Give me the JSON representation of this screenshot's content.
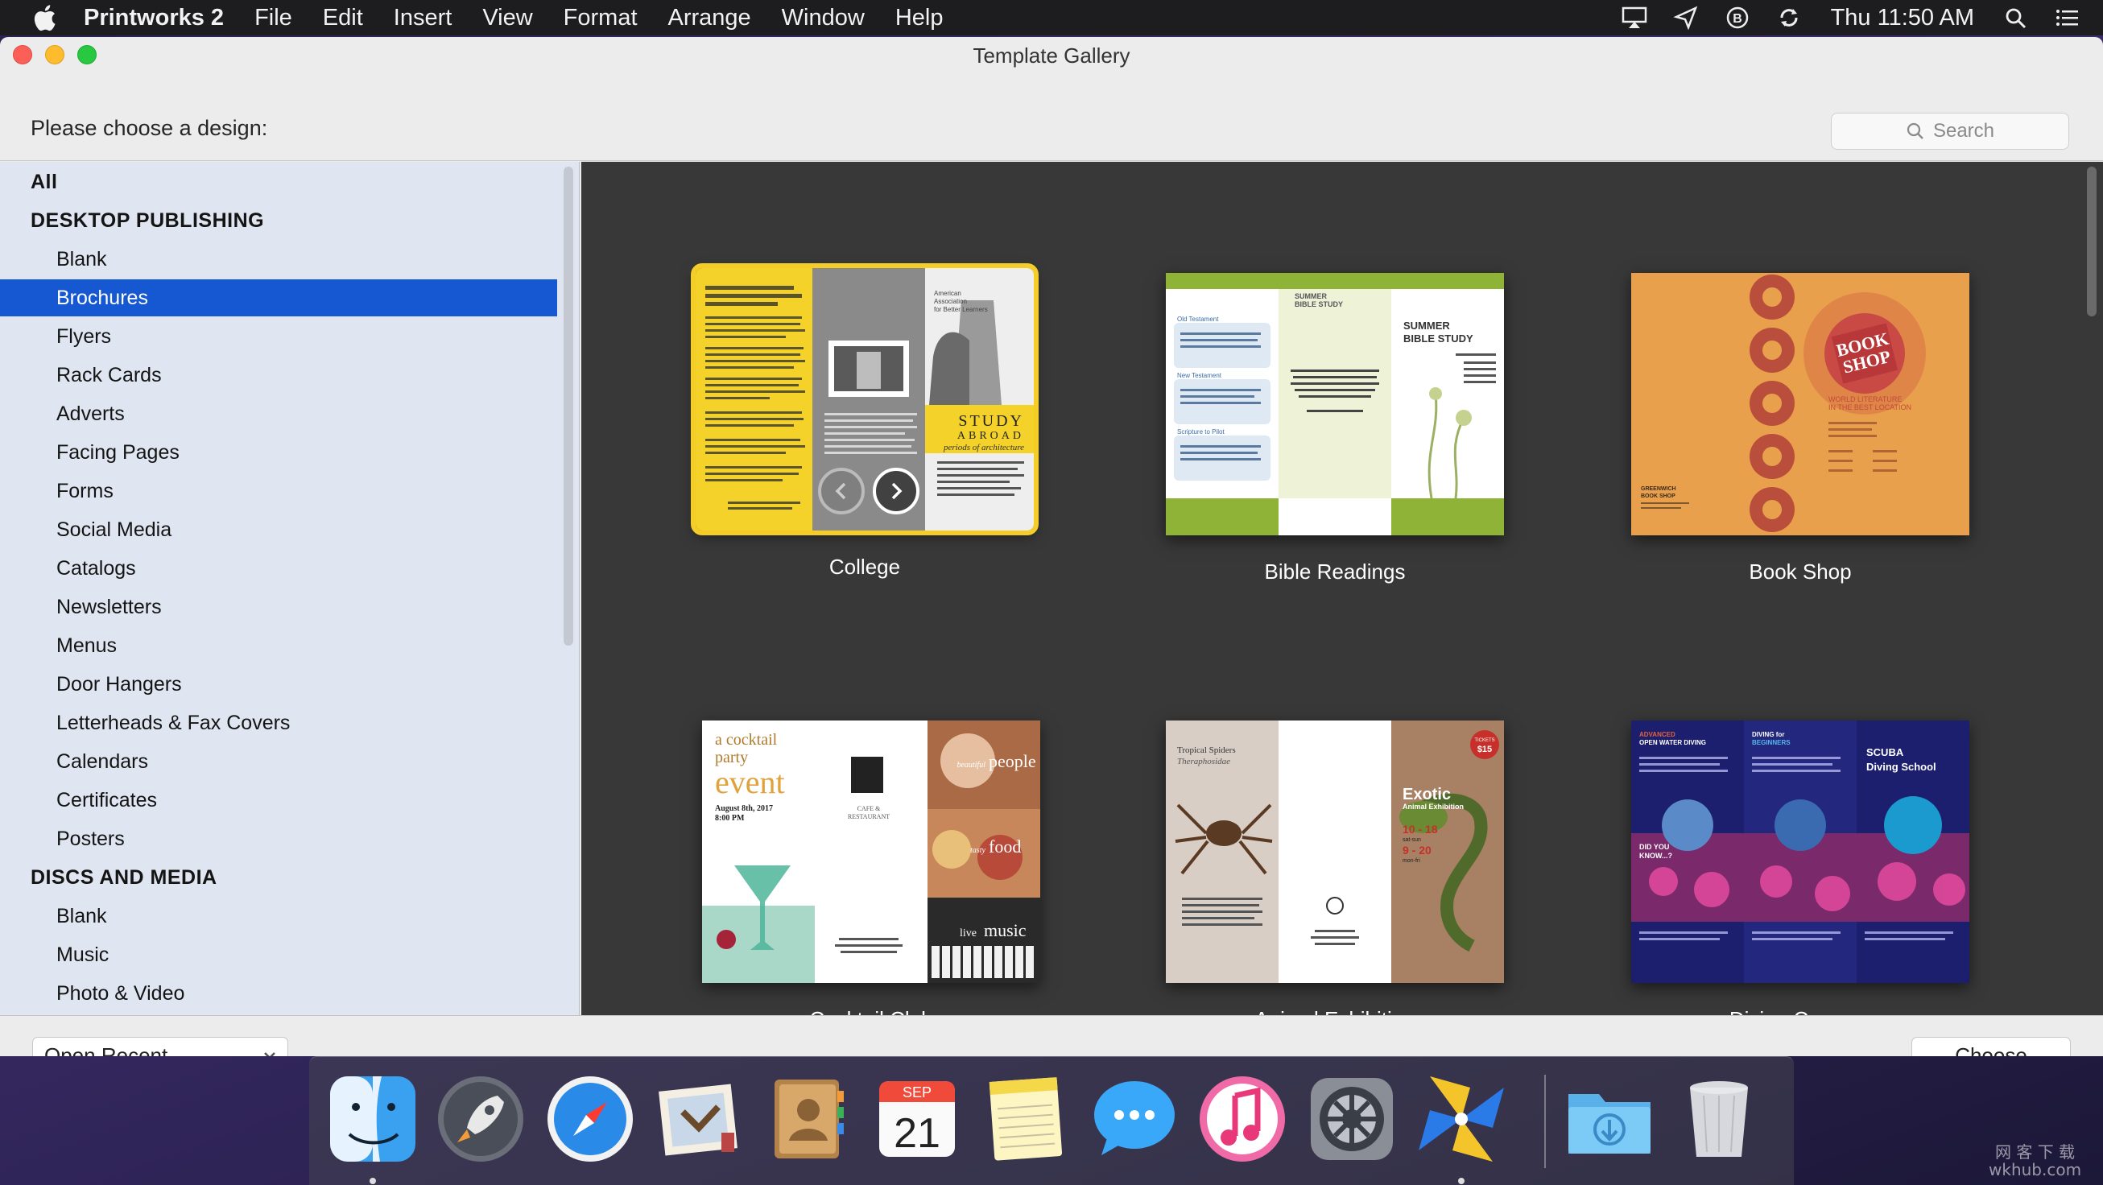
{
  "menubar": {
    "app_name": "Printworks 2",
    "items": [
      "File",
      "Edit",
      "Insert",
      "View",
      "Format",
      "Arrange",
      "Window",
      "Help"
    ],
    "clock": "Thu 11:50 AM",
    "status_icons": [
      "airplay-icon",
      "location-icon",
      "bartender-icon",
      "sync-icon",
      "spotlight-icon",
      "notification-center-icon"
    ]
  },
  "window": {
    "title": "Template Gallery",
    "prompt": "Please choose a design:",
    "search_placeholder": "Search"
  },
  "sidebar": {
    "items": [
      {
        "label": "All",
        "type": "header"
      },
      {
        "label": "DESKTOP PUBLISHING",
        "type": "header"
      },
      {
        "label": "Blank",
        "type": "sub"
      },
      {
        "label": "Brochures",
        "type": "sub",
        "selected": true
      },
      {
        "label": "Flyers",
        "type": "sub"
      },
      {
        "label": "Rack Cards",
        "type": "sub"
      },
      {
        "label": "Adverts",
        "type": "sub"
      },
      {
        "label": "Facing Pages",
        "type": "sub"
      },
      {
        "label": "Forms",
        "type": "sub"
      },
      {
        "label": "Social Media",
        "type": "sub"
      },
      {
        "label": "Catalogs",
        "type": "sub"
      },
      {
        "label": "Newsletters",
        "type": "sub"
      },
      {
        "label": "Menus",
        "type": "sub"
      },
      {
        "label": "Door Hangers",
        "type": "sub"
      },
      {
        "label": "Letterheads & Fax Covers",
        "type": "sub"
      },
      {
        "label": "Calendars",
        "type": "sub"
      },
      {
        "label": "Certificates",
        "type": "sub"
      },
      {
        "label": "Posters",
        "type": "sub"
      },
      {
        "label": "DISCS AND MEDIA",
        "type": "header"
      },
      {
        "label": "Blank",
        "type": "sub"
      },
      {
        "label": "Music",
        "type": "sub"
      },
      {
        "label": "Photo & Video",
        "type": "sub"
      }
    ]
  },
  "gallery": {
    "templates": [
      {
        "name": "College",
        "selected": true,
        "text": {
          "heading": "STUDY",
          "heading2": "ABROAD",
          "tagline": "periods of architecture",
          "org1": "American",
          "org2": "Association",
          "org3": "for Better Learners"
        }
      },
      {
        "name": "Bible Readings",
        "text": {
          "title1": "SUMMER",
          "title2": "BIBLE STUDY",
          "col1": "Old Testament",
          "col2": "New Testament",
          "col3": "Scripture to Pilot"
        }
      },
      {
        "name": "Book Shop",
        "text": {
          "sign1": "BOOK",
          "sign2": "SHOP",
          "tag1": "WORLD LITERATURE",
          "tag2": "IN THE BEST LOCATION",
          "footer1": "GREENWICH",
          "footer2": "BOOK SHOP"
        }
      },
      {
        "name": "Cocktail Club",
        "text": {
          "line1": "a cocktail",
          "line2": "party",
          "line3": "event",
          "date": "August 8th, 2017",
          "time": "8:00 PM",
          "venue1": "CAFE &",
          "venue2": "RESTAURANT",
          "p1": "people",
          "p2": "food",
          "p3": "music",
          "p1pre": "beautiful",
          "p2pre": "tasty",
          "p3pre": "live"
        }
      },
      {
        "name": "Animal Exhibition",
        "text": {
          "left1": "Tropical Spiders",
          "left2": "Theraphosidae",
          "title": "Exotic",
          "subtitle": "Animal Exhibition",
          "dates1": "10 - 18",
          "dates1b": "sat-sun",
          "dates2": "9 - 20",
          "dates2b": "mon-fri",
          "badge1": "TICKETS",
          "badge2": "$15"
        }
      },
      {
        "name": "Diving Courses",
        "text": {
          "left1": "ADVANCED",
          "left2": "OPEN WATER DIVING",
          "mid1": "DIVING for",
          "mid2": "BEGINNERS",
          "right1": "SCUBA",
          "right2": "Diving School",
          "q1": "DID YOU",
          "q2": "KNOW...?"
        }
      }
    ]
  },
  "bottom": {
    "open_recent": "Open Recent",
    "choose": "Choose"
  },
  "dock": {
    "apps": [
      "finder-icon",
      "launchpad-icon",
      "safari-icon",
      "mail-icon",
      "contacts-icon",
      "calendar-icon",
      "notes-icon",
      "messages-icon",
      "itunes-icon",
      "system-preferences-icon",
      "printworks-icon",
      "downloads-folder-icon",
      "trash-icon"
    ],
    "calendar_month": "SEP",
    "calendar_day": "21"
  },
  "watermark": {
    "line1": "网 客 下 载",
    "line2": "wkhub.com"
  },
  "colors": {
    "selection": "#1657d2",
    "sidebar_bg": "#dfe5f1",
    "gallery_bg": "#383838",
    "selected_outline": "#f4cd28"
  }
}
